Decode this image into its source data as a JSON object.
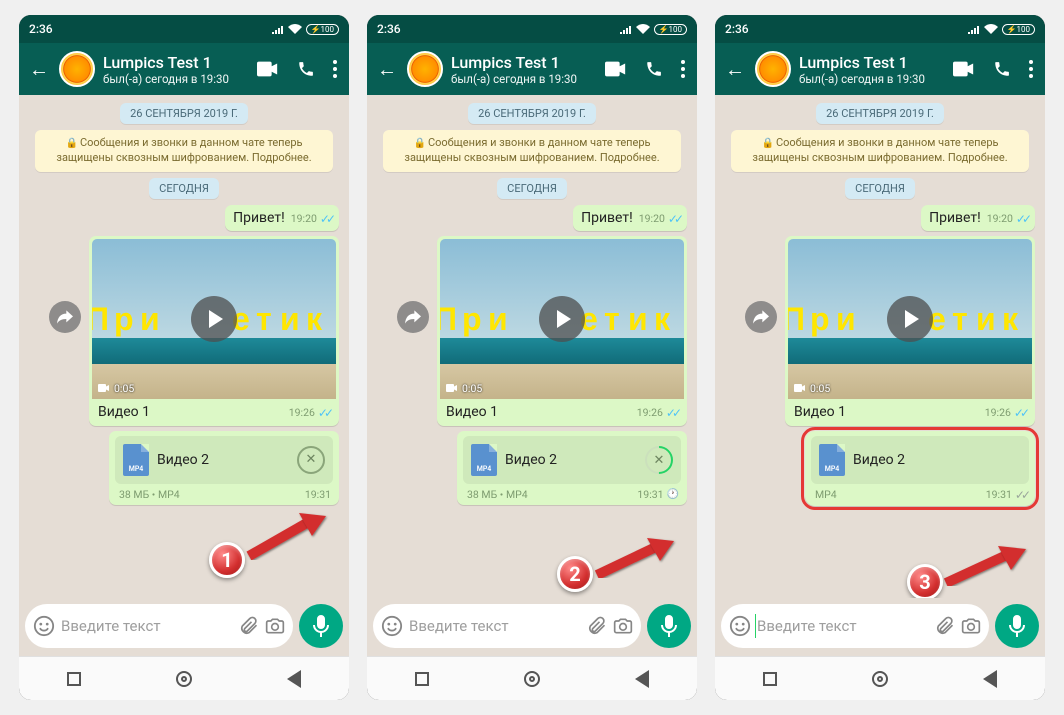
{
  "statusbar": {
    "time": "2:36",
    "battery": "100"
  },
  "header": {
    "contact_name": "Lumpics Test 1",
    "contact_status": "был(-а) сегодня в 19:30"
  },
  "chat": {
    "date_pill": "26 СЕНТЯБРЯ 2019 Г.",
    "encryption_notice": "Сообщения и звонки в данном чате теперь защищены сквозным шифрованием. Подробнее.",
    "today_pill": "СЕГОДНЯ",
    "greeting": {
      "text": "Привет!",
      "time": "19:20"
    },
    "video1": {
      "overlay_word": "Приветик",
      "duration": "0:05",
      "caption": "Видео 1",
      "time": "19:26"
    },
    "video2": {
      "name": "Видео 2",
      "ext_badge": "MP4",
      "meta_1": "38 МБ • MP4",
      "meta_3": "MP4",
      "time_1": "19:31",
      "time_2": "19:31",
      "time_3": "19:31"
    }
  },
  "input": {
    "placeholder": "Введите текст"
  },
  "steps": {
    "s1": "1",
    "s2": "2",
    "s3": "3"
  }
}
